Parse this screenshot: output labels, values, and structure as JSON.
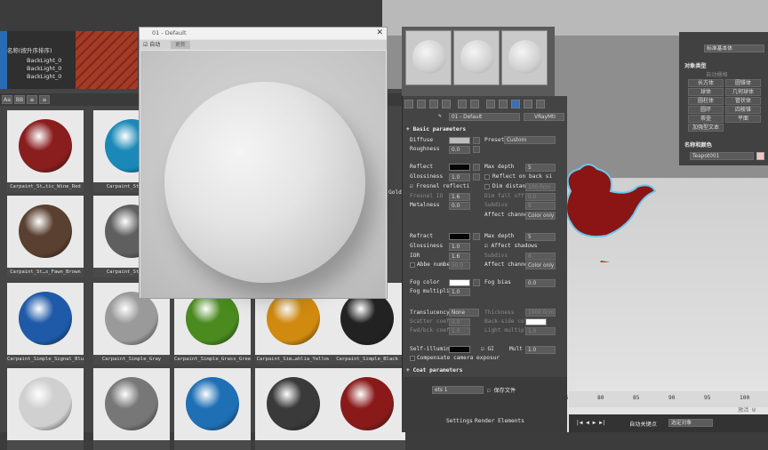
{
  "scene": {
    "header": "名称(按升序排序)",
    "items": [
      "BackLight_0",
      "BackLight_0",
      "BackLight_0"
    ]
  },
  "browser": {
    "toolbar": [
      "Aa",
      "BB",
      "≡",
      "≡"
    ],
    "materials": [
      {
        "label": "Carpaint_St…tic_Wine_Red",
        "color": "#8a1e1e"
      },
      {
        "label": "Carpaint_St…rquoi",
        "color": "#1a89b8"
      },
      {
        "label": "Carpaint_St…s_Fawn_Brown",
        "color": "#5a4030"
      },
      {
        "label": "Carpaint_Stochast",
        "color": "#5f5f5f"
      },
      {
        "label": "Carpaint_Simple_Signal_Blue",
        "color": "#1f5aa8"
      },
      {
        "label": "Carpaint_Simple_Gray",
        "color": "#9a9a9a"
      },
      {
        "label": "Carpaint_Simple_Grass_Green",
        "color": "#4a8a1e"
      },
      {
        "label": "Carpaint_Sim…ahlia_Yellow",
        "color": "#d08a10"
      },
      {
        "label": "Carpaint_Simple_Black",
        "color": "#222222"
      },
      {
        "label": "",
        "color": "#d0d0d0"
      },
      {
        "label": "",
        "color": "#777777"
      },
      {
        "label": "",
        "color": "#1f6fb5"
      },
      {
        "label": "",
        "color": "#3a3a3a"
      },
      {
        "label": "",
        "color": "#8a1a1a"
      }
    ],
    "right_labels": [
      "Gold"
    ]
  },
  "preview": {
    "title": "01 - Default",
    "auto_label": "自动",
    "update_label": "更新"
  },
  "editor": {
    "material_name": "01 - Default",
    "material_type": "VRayMtl",
    "sections": {
      "basic": "Basic parameters",
      "coat": "Coat parameters"
    },
    "basic": {
      "diffuse": "Diffuse",
      "preset_label": "Preset",
      "preset_value": "Custom",
      "roughness": "Roughness",
      "roughness_value": "0.0",
      "reflect": "Reflect",
      "max_depth": "Max depth",
      "max_depth_value": "5",
      "glossiness": "Glossiness",
      "glossiness_value": "1.0",
      "reflect_back": "Reflect on back si",
      "fresnel": "Fresnel reflecti",
      "dim_distance": "Dim distanc",
      "dim_distance_value": "100.0cm",
      "fresnel_ior": "Fresnel IO",
      "fresnel_ior_value": "1.6",
      "dim_falloff": "Dim fall off",
      "dim_falloff_value": "0.0",
      "subdivs": "Subdivs",
      "subdivs_value": "8",
      "metalness": "Metalness",
      "metalness_value": "0.0",
      "affect_channels": "Affect channe",
      "affect_channels_value": "Color only",
      "refract": "Refract",
      "refract_max_depth_value": "5",
      "refract_gloss_value": "1.0",
      "affect_shadows": "Affect shadows",
      "ior": "IOR",
      "ior_value": "1.6",
      "abbe": "Abbe number",
      "abbe_value": "50.0",
      "refract_subdivs_value": "8",
      "refract_affect_value": "Color only",
      "fog_color": "Fog color",
      "fog_bias": "Fog bias",
      "fog_bias_value": "0.0",
      "fog_multiplier": "Fog multiplie",
      "fog_multiplier_value": "1.0",
      "translucency": "Translucency",
      "translucency_value": "None",
      "thickness": "Thickness",
      "thickness_value": "1000.0cm",
      "scatter": "Scatter coeff",
      "scatter_value": "0.0",
      "backside": "Back-side colo",
      "fwdbck": "Fwd/bck coeff",
      "fwdbck_value": "1.0",
      "light_mult": "Light multipli",
      "light_mult_value": "1.0",
      "selfillum": "Self-illumina",
      "gi": "GI",
      "mult": "Mult",
      "mult_value": "1.0",
      "compensate": "Compensate camera exposur"
    }
  },
  "command_panel": {
    "dropdown": "标准基本体",
    "object_type": "对象类型",
    "autogrid": "自动栅格",
    "buttons": [
      "长方体",
      "圆锥体",
      "球体",
      "几何球体",
      "圆柱体",
      "管状体",
      "圆环",
      "四棱锥",
      "茶壶",
      "平面",
      "加强型文本"
    ],
    "name_color": "名称和颜色",
    "object_name": "Teapot001"
  },
  "bottom": {
    "save_label": "保存文件",
    "settings": "Settings",
    "render_elements": "Render Elements",
    "timeline_ticks": [
      "75",
      "80",
      "85",
      "90",
      "95",
      "100"
    ],
    "autokey": "自动关键点",
    "selected": "选定对象",
    "watermark": "激活 W"
  },
  "colors": {
    "teapot": "#8b1414",
    "accent": "#3b6fb6"
  }
}
